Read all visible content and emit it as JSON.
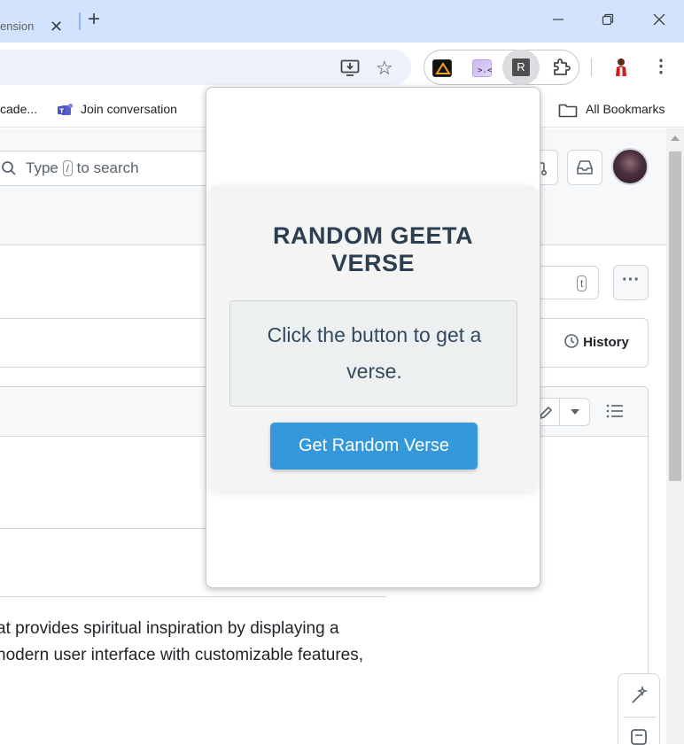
{
  "browser": {
    "tab": {
      "title": "ension",
      "close_glyph": "✕"
    },
    "new_tab_glyph": "+",
    "window": {
      "minimize": "—",
      "maximize": "❐",
      "close": "✕"
    },
    "toolbar": {
      "menu_glyph": "⋮",
      "extensions": [
        "extension-icon-1",
        "extension-icon-2",
        "random-geeta-extension",
        "extensions-puzzle-icon"
      ],
      "active_extension_letter": "R"
    },
    "bookmarks": [
      {
        "label": "cade..."
      },
      {
        "label": "Join conversation"
      },
      {
        "label": "All Bookmarks"
      }
    ]
  },
  "page": {
    "search": {
      "before": "Type",
      "key": "/",
      "after": "to search"
    },
    "shortcut_key": "t",
    "more_glyph": "···",
    "history_partial": "v",
    "history_label": "History",
    "description_lines": [
      "at provides spiritual inspiration by displaying a",
      "nodern user interface with customizable features,"
    ]
  },
  "popup": {
    "title": "RANDOM GEETA VERSE",
    "verse_placeholder": "Click the button to get a verse.",
    "button_label": "Get Random Verse",
    "colors": {
      "title": "#2c3e50",
      "button": "#3498db",
      "verse_bg": "#ecf0f1"
    }
  }
}
